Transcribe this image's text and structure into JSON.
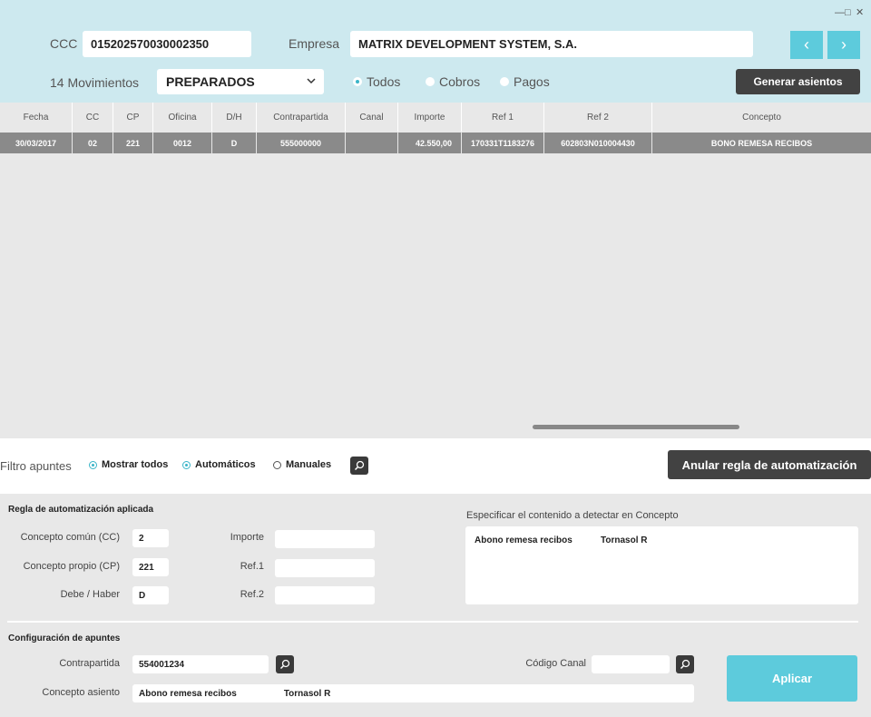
{
  "window": {
    "minimize": "—",
    "maximize": "□",
    "close": "✕"
  },
  "header": {
    "ccc_label": "CCC",
    "ccc_value": "015202570030002350",
    "empresa_label": "Empresa",
    "empresa_value": "MATRIX DEVELOPMENT SYSTEM, S.A.",
    "prev_icon": "‹",
    "next_icon": "›",
    "movimientos_label": "14 Movimientos",
    "estado_value": "PREPARADOS",
    "radios": [
      "Todos",
      "Cobros",
      "Pagos"
    ],
    "generar_label": "Generar asientos"
  },
  "table": {
    "columns": [
      "Fecha",
      "CC",
      "CP",
      "Oficina",
      "D/H",
      "Contrapartida",
      "Canal",
      "Importe",
      "Ref 1",
      "Ref 2",
      "Concepto"
    ],
    "rows": [
      [
        "30/03/2017",
        "02",
        "221",
        "0012",
        "D",
        "555000000",
        "",
        "42.550,00",
        "170331T1183276",
        "602803N010004430",
        "BONO REMESA RECIBOS"
      ]
    ]
  },
  "filter": {
    "label": "Filtro apuntes",
    "options": [
      "Mostrar todos",
      "Automáticos",
      "Manuales"
    ],
    "anular_label": "Anular regla de automatización"
  },
  "regla": {
    "title": "Regla de automatización aplicada",
    "cc_label": "Concepto común (CC)",
    "cc_value": "2",
    "cp_label": "Concepto propio (CP)",
    "cp_value": "221",
    "dh_label": "Debe / Haber",
    "dh_value": "D",
    "importe_label": "Importe",
    "importe_value": "",
    "ref1_label": "Ref.1",
    "ref1_value": "",
    "ref2_label": "Ref.2",
    "ref2_value": "",
    "concepto_label": "Especificar el contenido a detectar en Concepto",
    "concepto_part1": "Abono remesa recibos",
    "concepto_part2": "Tornasol R"
  },
  "config": {
    "title": "Configuración de apuntes",
    "contrapartida_label": "Contrapartida",
    "contrapartida_value": "554001234",
    "canal_label": "Código Canal",
    "canal_value": "",
    "asiento_label": "Concepto asiento",
    "asiento_part1": "Abono remesa recibos",
    "asiento_part2": "Tornasol R",
    "aplicar_label": "Aplicar"
  },
  "colors": {
    "header_bg": "#cde9ef",
    "accent": "#5dcbdc",
    "dark_button": "#424242",
    "row_selected": "#8a8a8a",
    "panel_bg": "#e8e8e8"
  }
}
